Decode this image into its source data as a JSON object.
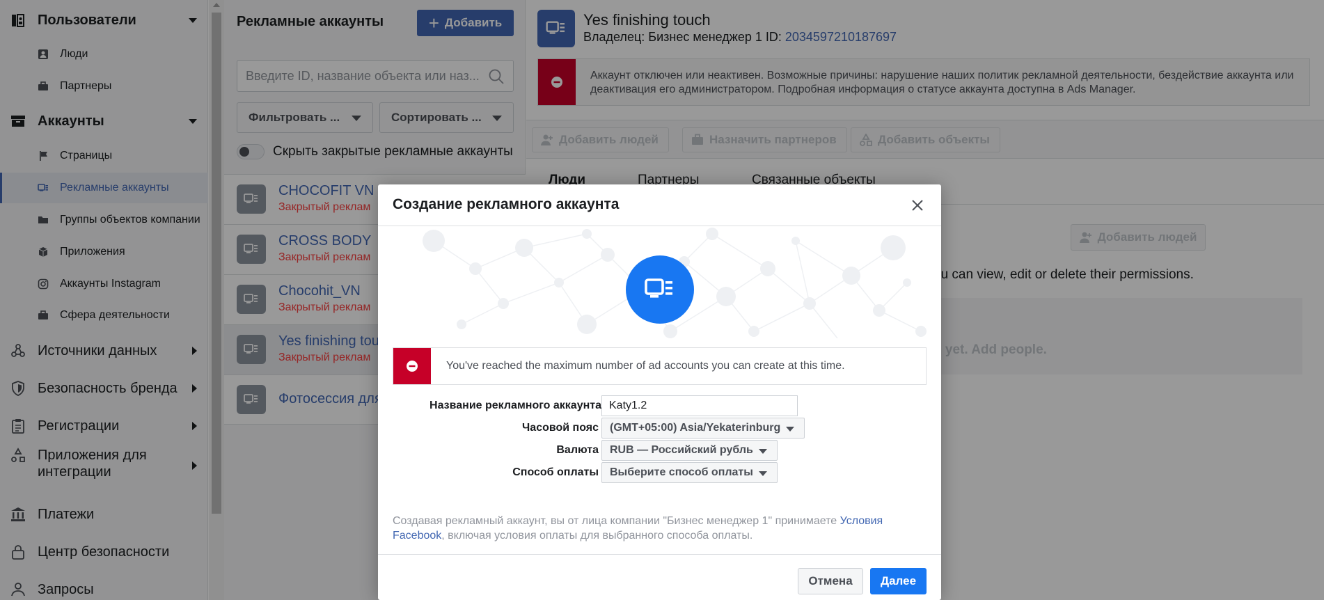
{
  "sidebar": {
    "users": {
      "label": "Пользователи",
      "items": [
        "Люди",
        "Партнеры"
      ]
    },
    "accounts": {
      "label": "Аккаунты",
      "items": [
        "Страницы",
        "Рекламные аккаунты",
        "Группы объектов компании",
        "Приложения",
        "Аккаунты Instagram",
        "Сфера деятельности"
      ]
    },
    "data_sources": "Источники данных",
    "brand_safety": "Безопасность бренда",
    "registrations": "Регистрации",
    "integrations": "Приложения для интеграции",
    "payments": "Платежи",
    "security_center": "Центр безопасности",
    "requests": "Запросы"
  },
  "middle": {
    "title": "Рекламные аккаунты",
    "add_label": "Добавить",
    "search_placeholder": "Введите ID, название объекта или наз...",
    "filter_label": "Фильтровать ...",
    "sort_label": "Сортировать ...",
    "toggle_label": "Скрыть закрытые рекламные аккаунты",
    "accounts": [
      {
        "name": "CHOCOFIT VN",
        "status": "Закрытый реклам"
      },
      {
        "name": "CROSS BODY",
        "status": "Закрытый реклам"
      },
      {
        "name": "Chocohit_VN",
        "status": "Закрытый реклам"
      },
      {
        "name": "Yes finishing touc",
        "status": "Закрытый реклам"
      },
      {
        "name": "Фотосессия для",
        "status": ""
      }
    ]
  },
  "right": {
    "title": "Yes finishing touch",
    "owner_prefix": "Владелец: Бизнес менеджер 1  ID:",
    "owner_id": "2034597210187697",
    "warning": "Аккаунт отключен или неактивен. Возможные причины: нарушение наших политик рекламной деятельности, бездействие аккаунта или деактивация его администратором. Подробная информация о статусе аккаунта доступна в Ads Manager.",
    "toolbar": {
      "add_people": "Добавить людей",
      "assign_partners": "Назначить партнеров",
      "add_assets": "Добавить объекты"
    },
    "tabs": [
      "Люди",
      "Партнеры",
      "Связанные объекты"
    ],
    "add_people_button": "Добавить людей",
    "description_fragment": "ou can view, edit or delete their permissions.",
    "empty_fragment": "d yet. Add people."
  },
  "modal": {
    "title": "Создание рекламного аккаунта",
    "error": "You've reached the maximum number of ad accounts you can create at this time.",
    "fields": {
      "name_label": "Название рекламного аккаунта",
      "name_value": "Katy1.2",
      "timezone_label": "Часовой пояс",
      "timezone_value": "(GMT+05:00) Asia/Yekaterinburg",
      "currency_label": "Валюта",
      "currency_value": "RUB — Российский рубль",
      "payment_label": "Способ оплаты",
      "payment_value": "Выберите способ оплаты"
    },
    "terms_prefix": "Создавая рекламный аккаунт, вы от лица компании \"Бизнес менеджер 1\" принимаете ",
    "terms_link": "Условия Facebook",
    "terms_suffix": ", включая условия оплаты для выбранного способа оплаты.",
    "cancel_label": "Отмена",
    "next_label": "Далее"
  },
  "colors": {
    "accent": "#4267b2",
    "primary_button": "#1877f2",
    "error_red": "#c60028",
    "status_red": "#fa3e3e"
  }
}
